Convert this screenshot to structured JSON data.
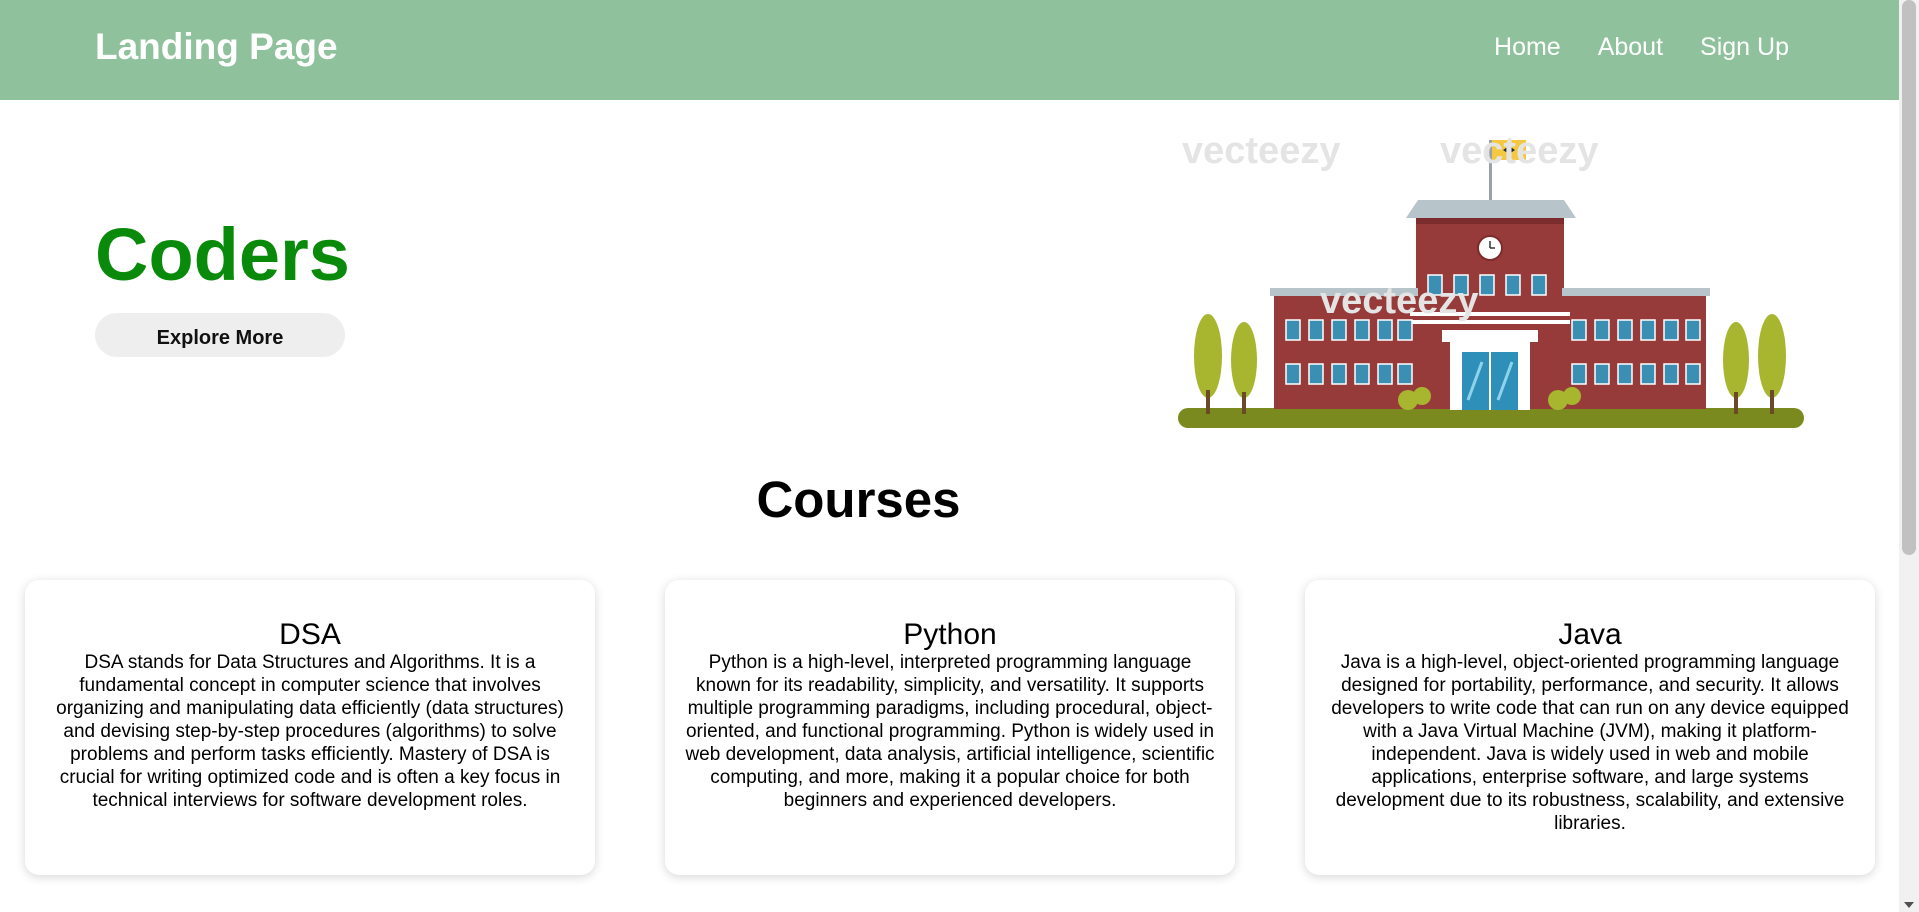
{
  "navbar": {
    "brand": "Landing Page",
    "links": [
      {
        "label": "Home"
      },
      {
        "label": "About"
      },
      {
        "label": "Sign Up"
      }
    ],
    "background_color": "#8fc29c"
  },
  "hero": {
    "title": "Coders",
    "title_color": "#0a8a0a",
    "button_label": "Explore More",
    "image": {
      "subject": "school-building-illustration",
      "watermark_text": "vecteezy"
    }
  },
  "courses": {
    "heading": "Courses",
    "items": [
      {
        "title": "DSA",
        "description": "DSA stands for Data Structures and Algorithms. It is a fundamental concept in computer science that involves organizing and manipulating data efficiently (data structures) and devising step-by-step procedures (algorithms) to solve problems and perform tasks efficiently. Mastery of DSA is crucial for writing optimized code and is often a key focus in technical interviews for software development roles."
      },
      {
        "title": "Python",
        "description": "Python is a high-level, interpreted programming language known for its readability, simplicity, and versatility. It supports multiple programming paradigms, including procedural, object-oriented, and functional programming. Python is widely used in web development, data analysis, artificial intelligence, scientific computing, and more, making it a popular choice for both beginners and experienced developers."
      },
      {
        "title": "Java",
        "description": "Java is a high-level, object-oriented programming language designed for portability, performance, and security. It allows developers to write code that can run on any device equipped with a Java Virtual Machine (JVM), making it platform-independent. Java is widely used in web and mobile applications, enterprise software, and large systems development due to its robustness, scalability, and extensive libraries."
      }
    ]
  }
}
